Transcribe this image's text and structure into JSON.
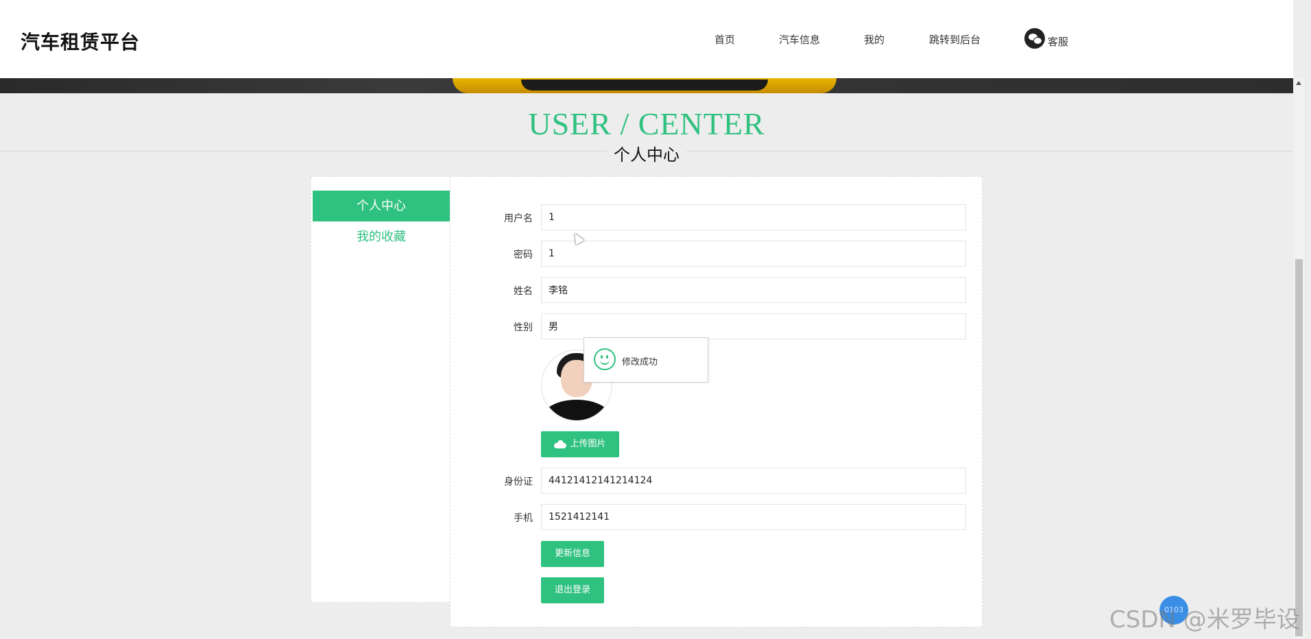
{
  "header": {
    "brand": "汽车租赁平台",
    "nav": [
      "首页",
      "汽车信息",
      "我的",
      "跳转到后台"
    ],
    "service_label": "客服",
    "service_icon": "wechat-icon"
  },
  "section": {
    "title_en": "USER / CENTER",
    "title_cn": "个人中心"
  },
  "sidebar": {
    "items": [
      {
        "label": "个人中心",
        "active": true
      },
      {
        "label": "我的收藏",
        "active": false
      }
    ]
  },
  "form": {
    "fields": [
      {
        "label": "用户名",
        "value": "1"
      },
      {
        "label": "密码",
        "value": "1"
      },
      {
        "label": "姓名",
        "value": "李铭"
      },
      {
        "label": "性别",
        "value": "男"
      },
      {
        "label": "身份证",
        "value": "44121412141214124"
      },
      {
        "label": "手机",
        "value": "1521412141"
      }
    ],
    "upload_label": "上传图片",
    "update_label": "更新信息",
    "logout_label": "退出登录"
  },
  "toast": {
    "message": "修改成功",
    "icon": "smile-icon"
  },
  "watermark": {
    "text": "CSDN @米罗毕设",
    "badge_text": "0103"
  },
  "colors": {
    "accent": "#2fc17f",
    "background": "#ededed"
  }
}
